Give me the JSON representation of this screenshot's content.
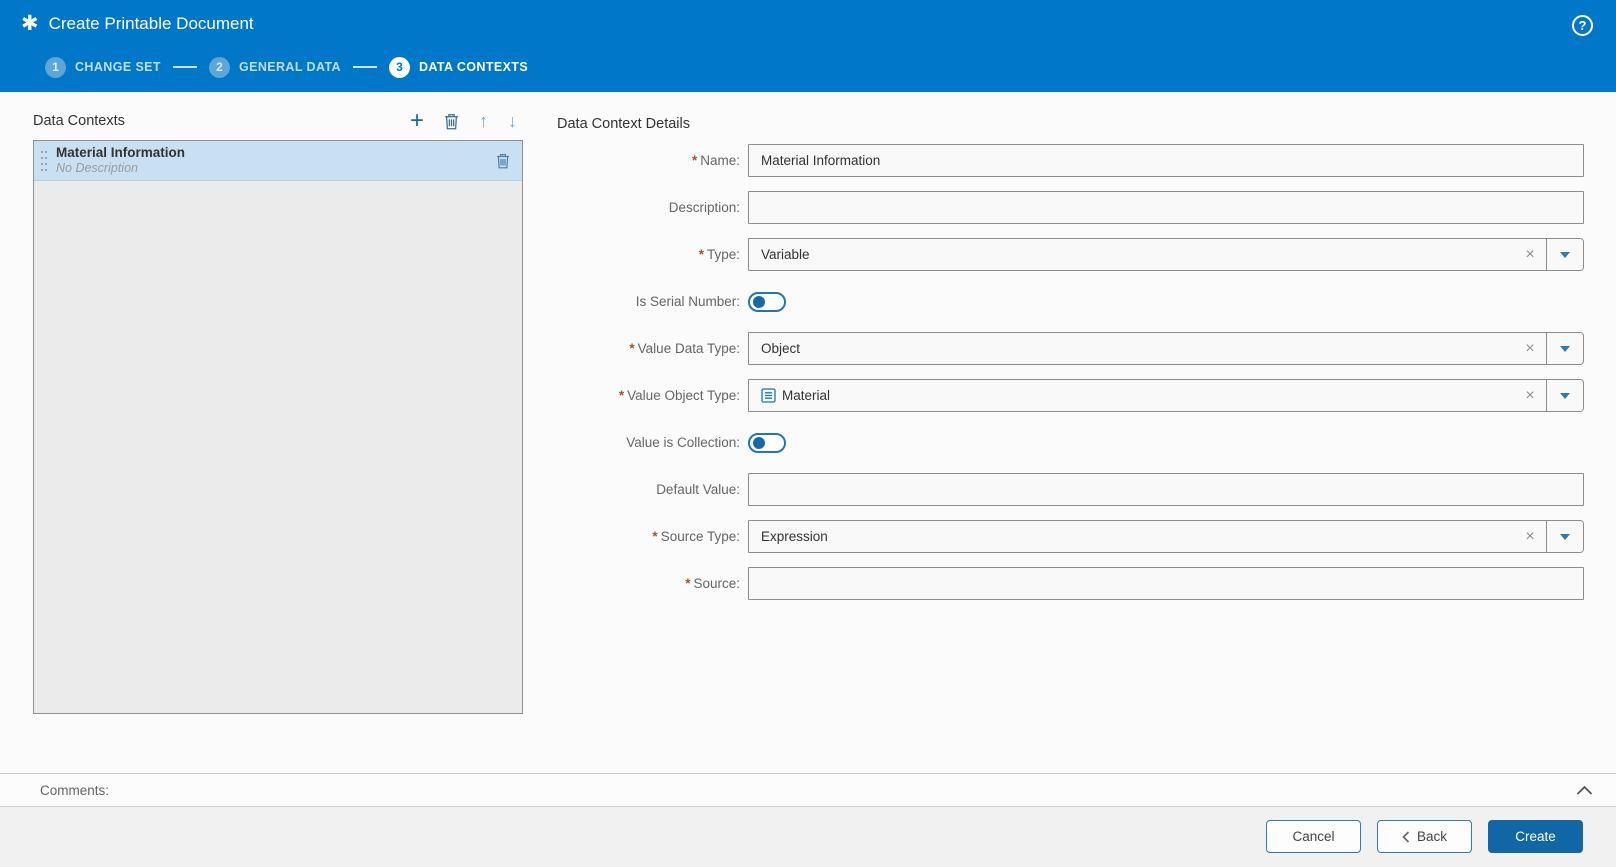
{
  "header": {
    "app_icon_glyph": "✱",
    "title": "Create Printable Document",
    "help_icon_glyph": "?",
    "steps": [
      {
        "key": "change-set",
        "number": "1",
        "label": "CHANGE SET",
        "state": "done"
      },
      {
        "key": "general-data",
        "number": "2",
        "label": "GENERAL DATA",
        "state": "done"
      },
      {
        "key": "data-contexts",
        "number": "3",
        "label": "DATA CONTEXTS",
        "state": "active"
      }
    ]
  },
  "left_panel": {
    "title": "Data Contexts",
    "toolbar": {
      "add_glyph": "+",
      "delete_icon": "trash-icon",
      "move_up_glyph": "↑",
      "move_down_glyph": "↓"
    },
    "items": [
      {
        "name": "Material Information",
        "description": "No Description",
        "selected": true
      }
    ]
  },
  "details": {
    "title": "Data Context Details",
    "required_marker": "*",
    "combo_clear_glyph": "×",
    "fields": [
      {
        "key": "name",
        "label": "Name:",
        "required": true,
        "control": "text",
        "value": "Material Information"
      },
      {
        "key": "description",
        "label": "Description:",
        "required": false,
        "control": "text",
        "value": ""
      },
      {
        "key": "type",
        "label": "Type:",
        "required": true,
        "control": "combo",
        "value": "Variable"
      },
      {
        "key": "is-serial-number",
        "label": "Is Serial Number:",
        "required": false,
        "control": "toggle",
        "state": "off"
      },
      {
        "key": "value-data-type",
        "label": "Value Data Type:",
        "required": true,
        "control": "combo",
        "value": "Object"
      },
      {
        "key": "value-object-type",
        "label": "Value Object Type:",
        "required": true,
        "control": "combo",
        "value": "Material",
        "value_icon": "material-type-icon"
      },
      {
        "key": "value-is-collection",
        "label": "Value is Collection:",
        "required": false,
        "control": "toggle",
        "state": "off"
      },
      {
        "key": "default-value",
        "label": "Default Value:",
        "required": false,
        "control": "text",
        "value": ""
      },
      {
        "key": "source-type",
        "label": "Source Type:",
        "required": true,
        "control": "combo",
        "value": "Expression"
      },
      {
        "key": "source",
        "label": "Source:",
        "required": true,
        "control": "text",
        "value": ""
      }
    ]
  },
  "comments": {
    "label": "Comments:",
    "collapse_icon": "chevron-up-icon"
  },
  "footer": {
    "cancel_label": "Cancel",
    "back_label": "Back",
    "create_label": "Create"
  },
  "colors": {
    "header_blue": "#0077c8",
    "accent_blue": "#1166a5",
    "selected_item_bg": "#c9e0f2",
    "required_marker": "#a5512b"
  }
}
